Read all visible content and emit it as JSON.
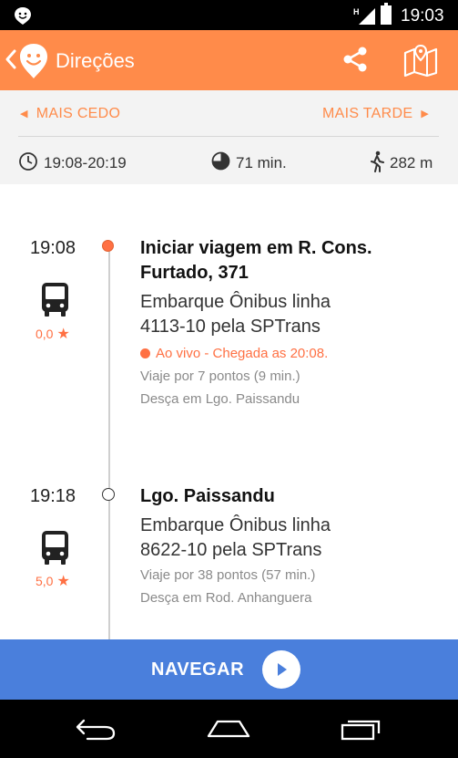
{
  "status_bar": {
    "time": "19:03",
    "icons": [
      "app-notification-icon",
      "signal-icon",
      "battery-icon"
    ]
  },
  "app_bar": {
    "title": "Direções",
    "icons": [
      "back-icon",
      "moovit-logo-icon",
      "share-icon",
      "map-icon"
    ]
  },
  "navigation": {
    "earlier_label": "MAIS CEDO",
    "later_label": "MAIS TARDE"
  },
  "summary": {
    "time_range": "19:08-20:19",
    "duration": "71 min.",
    "walk_distance": "282 m"
  },
  "steps": [
    {
      "time": "19:08",
      "title_line1": "Iniciar viagem em R. Cons.",
      "title_line2": "Furtado, 371",
      "desc_line1": "Embarque Ônibus linha",
      "desc_line2": "4113-10 pela SPTrans",
      "live": "Ao vivo - Chegada as 20:08.",
      "stops": "Viaje por 7 pontos (9 min.)",
      "alight": "Desça em Lgo. Paissandu",
      "rating": "0,0"
    },
    {
      "time": "19:18",
      "title": "Lgo. Paissandu",
      "desc_line1": "Embarque Ônibus linha",
      "desc_line2": "8622-10 pela SPTrans",
      "stops": "Viaje por 38 pontos (57 min.)",
      "alight": "Desça em Rod. Anhanguera",
      "rating": "5,0"
    }
  ],
  "bottom_button": {
    "label": "NAVEGAR"
  },
  "colors": {
    "accent": "#ff8b4a",
    "live": "#ff7043",
    "button": "#4a7fdc"
  }
}
